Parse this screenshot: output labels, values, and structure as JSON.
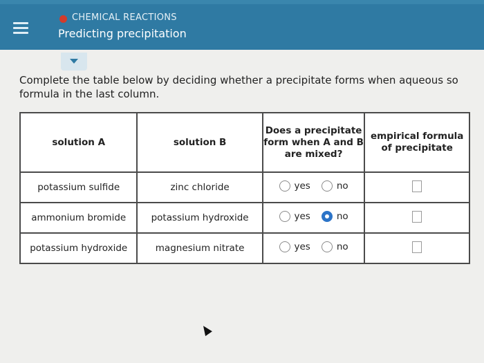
{
  "header": {
    "topic": "CHEMICAL REACTIONS",
    "title": "Predicting precipitation"
  },
  "instructions": "Complete the table below by deciding whether a precipitate forms when aqueous so formula in the last column.",
  "instructions_line1": "Complete the table below by deciding whether a precipitate forms when aqueous so",
  "instructions_line2": "formula in the last column.",
  "table": {
    "headers": {
      "solution_a": "solution A",
      "solution_b": "solution B",
      "precipitate_q": "Does a precipitate form when A and B are mixed?",
      "formula": "empirical formula of precipitate"
    },
    "yes_label": "yes",
    "no_label": "no",
    "rows": [
      {
        "a": "potassium sulfide",
        "b": "zinc chloride",
        "selected": "none"
      },
      {
        "a": "ammonium bromide",
        "b": "potassium hydroxide",
        "selected": "no"
      },
      {
        "a": "potassium hydroxide",
        "b": "magnesium nitrate",
        "selected": "none"
      }
    ]
  }
}
